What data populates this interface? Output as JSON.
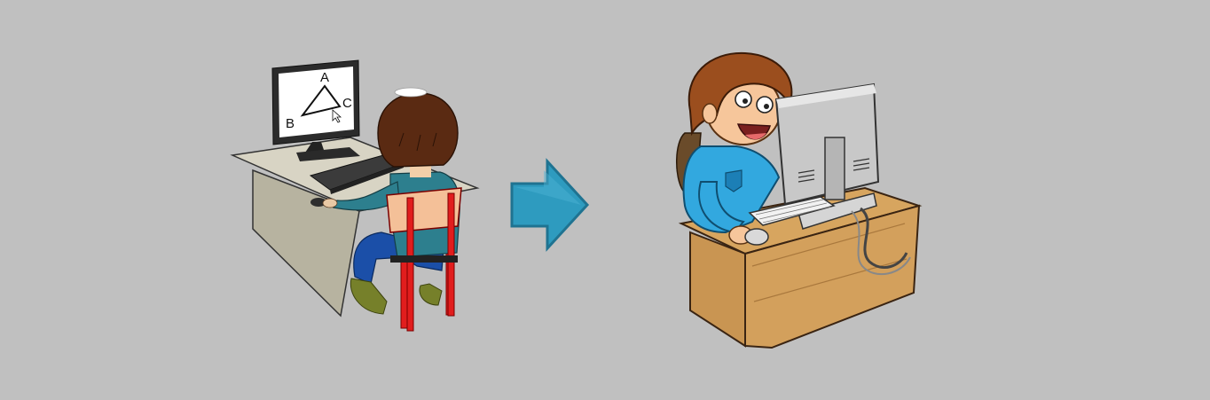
{
  "colors": {
    "background": "#c0c0c0",
    "arrow": "#2e9bbf",
    "arrow_outline": "#1f7391"
  },
  "icons": {
    "left": "student-at-computer-drawing-triangle-icon",
    "middle": "right-arrow-icon",
    "right": "happy-boy-at-computer-icon"
  },
  "screen_labels": {
    "a": "A",
    "b": "B",
    "c": "C"
  }
}
